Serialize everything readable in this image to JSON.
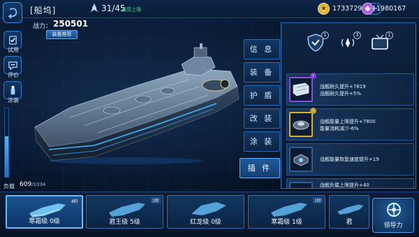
{
  "header": {
    "title": "[船坞]",
    "ship_count": "31/45",
    "ship_cap_note": "最高上限",
    "gold": "1733729",
    "gems": "1980167",
    "gold_icon": "star-coin-icon",
    "gem_icon": "purple-gem-icon"
  },
  "power": {
    "label": "战力：",
    "value": "250501",
    "recommend_label": "装备推荐"
  },
  "side_menu": [
    {
      "label": "试用",
      "icon": "check-doc-icon"
    },
    {
      "label": "评价",
      "icon": "comment-icon"
    },
    {
      "label": "涂装",
      "icon": "paint-bottle-icon"
    }
  ],
  "load": {
    "label": "负载",
    "current": "609",
    "max": "/1034",
    "fraction": 0.589
  },
  "tabs": [
    {
      "label": "信 息",
      "active": false
    },
    {
      "label": "装 备",
      "active": false
    },
    {
      "label": "护 盾",
      "active": false
    },
    {
      "label": "改 装",
      "active": false
    },
    {
      "label": "涂 装",
      "active": false
    },
    {
      "label": "插 件",
      "active": true
    }
  ],
  "plugin_slots": [
    {
      "icon": "shield-badge-icon",
      "count": "1"
    },
    {
      "icon": "ship-signal-icon",
      "count": "3"
    },
    {
      "icon": "tv-screen-icon",
      "count": "1"
    }
  ],
  "plugins": [
    {
      "grade": "I",
      "frame": "purple",
      "line1": "战舰耐久提升+7819",
      "line2": "战舰耐久提升+5%"
    },
    {
      "grade": "I",
      "frame": "gold",
      "line1": "战舰能量上限提升+7800",
      "line2": "能量消耗减少-6%"
    },
    {
      "grade": "I",
      "frame": "none",
      "line1": "战舰能量恢复速度提升+19",
      "line2": ""
    },
    {
      "grade": "I",
      "frame": "none",
      "line1": "战舰负载上限提升+40",
      "line2": ""
    }
  ],
  "ship_list": [
    {
      "name": "寒霜级 0级",
      "tag": "8阶",
      "active": true
    },
    {
      "name": "君王级 5级",
      "tag": "1阶",
      "active": false
    },
    {
      "name": "红龙级 0级",
      "tag": "",
      "active": false
    },
    {
      "name": "寒霜级 1级",
      "tag": "1阶",
      "active": false
    },
    {
      "name": "君",
      "tag": "",
      "active": false
    }
  ],
  "lead_button": {
    "label": "领导力",
    "icon": "steering-wheel-icon"
  },
  "colors": {
    "accent": "#3a8fe0",
    "cap_green": "#35e07a",
    "purple_frame": "#8a4de0",
    "gold_frame": "#d5b526"
  }
}
